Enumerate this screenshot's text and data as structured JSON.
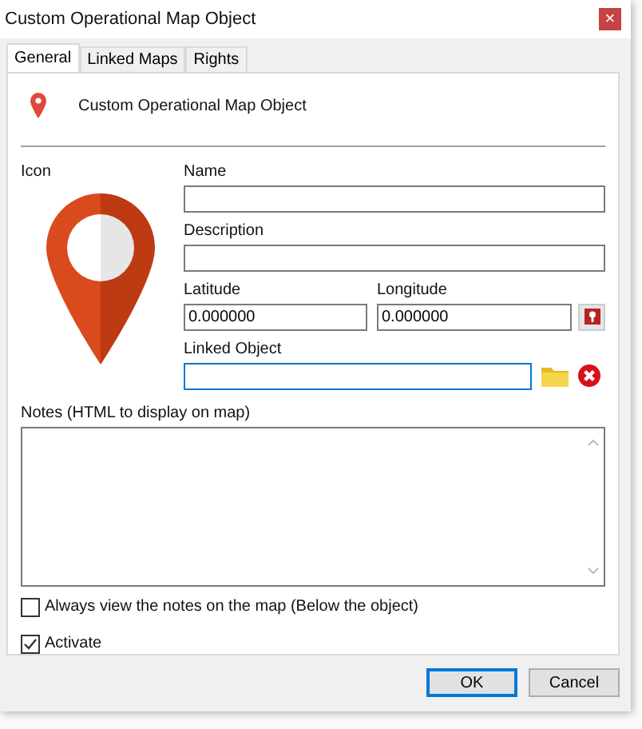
{
  "window": {
    "title": "Custom Operational Map Object",
    "close": "×"
  },
  "tabs": [
    {
      "label": "General",
      "selected": true
    },
    {
      "label": "Linked Maps",
      "selected": false
    },
    {
      "label": "Rights",
      "selected": false
    }
  ],
  "header": {
    "title": "Custom Operational Map Object"
  },
  "icon_label": "Icon",
  "name": {
    "label": "Name"
  },
  "description": {
    "label": "Description"
  },
  "latitude": {
    "label": "Latitude",
    "value": "0.000000"
  },
  "longitude": {
    "label": "Longitude",
    "value": "0.000000"
  },
  "linked_object": {
    "label": "Linked Object",
    "focused": true
  },
  "notes": {
    "label": "Notes (HTML to display on map)"
  },
  "checkboxes": [
    {
      "label": "Always view the notes on the map (Below the object)",
      "checked": false
    },
    {
      "label": "Activate",
      "checked": true
    }
  ],
  "buttons": [
    {
      "label": "OK",
      "default": true
    },
    {
      "label": "Cancel",
      "default": false
    }
  ]
}
